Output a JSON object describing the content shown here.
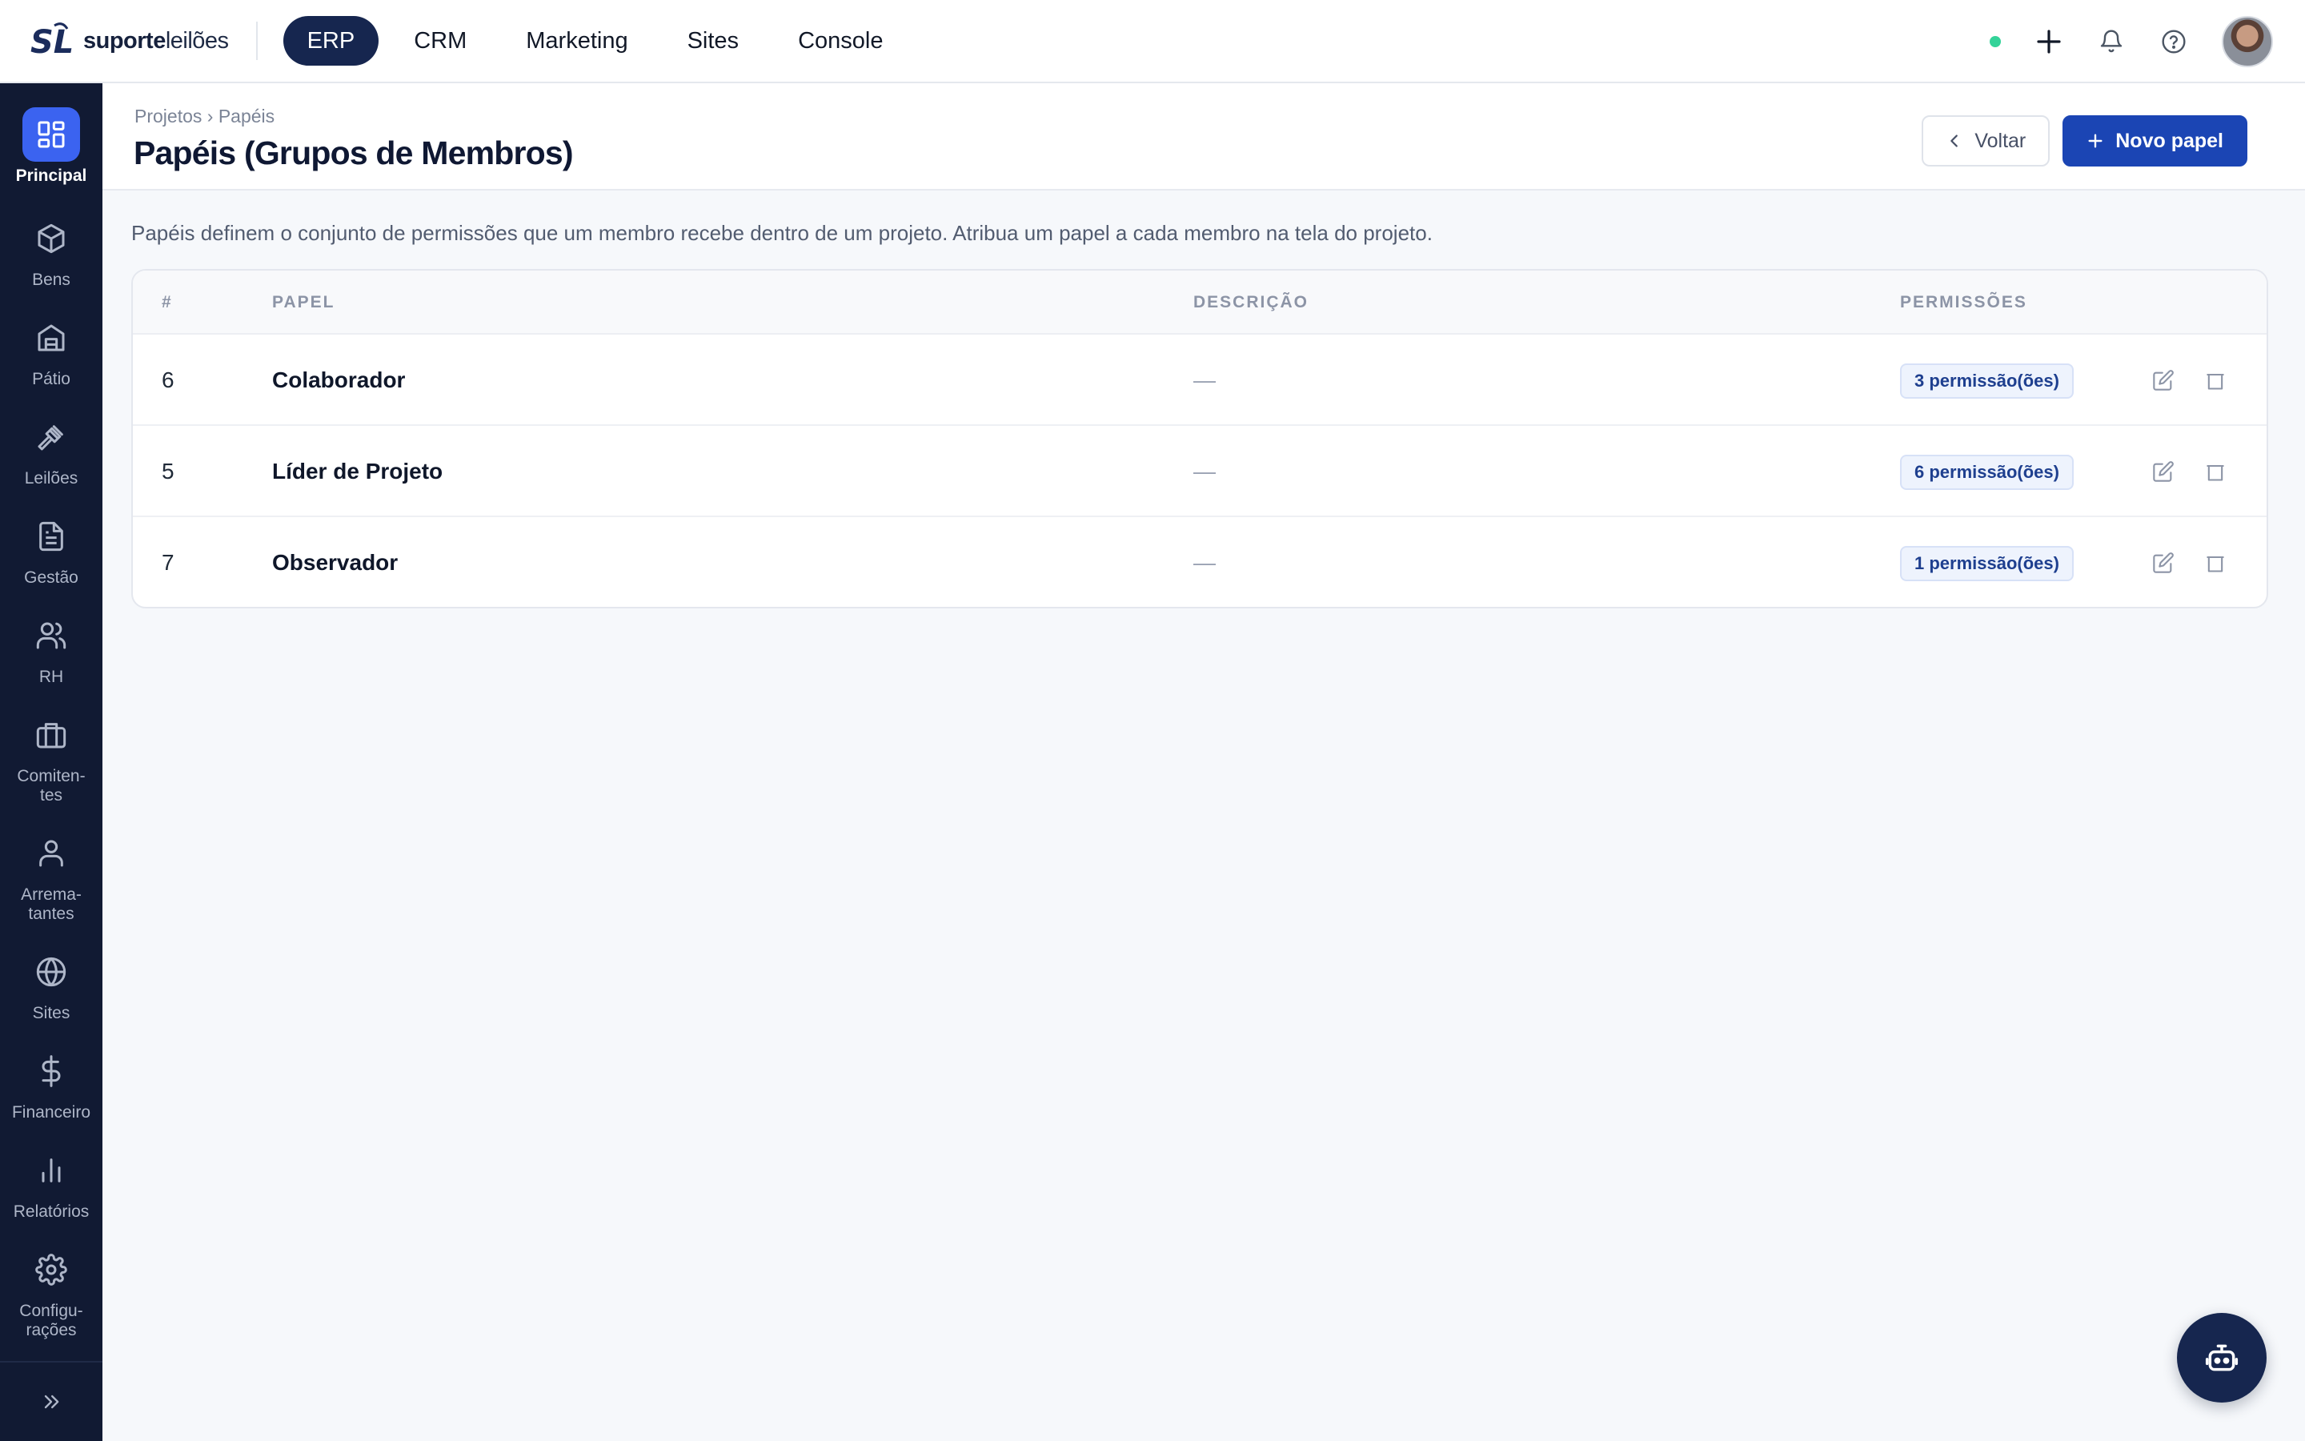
{
  "brand": {
    "bold": "suporte",
    "light": "leilões",
    "mark": "SL"
  },
  "topnav": [
    {
      "label": "ERP",
      "active": true
    },
    {
      "label": "CRM",
      "active": false
    },
    {
      "label": "Marketing",
      "active": false
    },
    {
      "label": "Sites",
      "active": false
    },
    {
      "label": "Console",
      "active": false
    }
  ],
  "sidebar": {
    "items": [
      {
        "label": "Principal",
        "icon": "dashboard-icon",
        "active": true
      },
      {
        "label": "Bens",
        "icon": "box-icon"
      },
      {
        "label": "Pátio",
        "icon": "warehouse-icon"
      },
      {
        "label": "Leilões",
        "icon": "gavel-icon"
      },
      {
        "label": "Gestão",
        "icon": "document-icon"
      },
      {
        "label": "RH",
        "icon": "users-icon"
      },
      {
        "label": "Comiten-\ntes",
        "icon": "briefcase-icon"
      },
      {
        "label": "Arrema-\ntantes",
        "icon": "user-icon"
      },
      {
        "label": "Sites",
        "icon": "globe-icon"
      },
      {
        "label": "Financeiro",
        "icon": "dollar-icon"
      },
      {
        "label": "Relatórios",
        "icon": "bar-chart-icon"
      },
      {
        "label": "Configu-\nrações",
        "icon": "gear-icon"
      }
    ]
  },
  "header": {
    "breadcrumb": "Projetos › Papéis",
    "title": "Papéis (Grupos de Membros)",
    "back_label": "Voltar",
    "new_label": "Novo papel"
  },
  "intro": "Papéis definem o conjunto de permissões que um membro recebe dentro de um projeto. Atribua um papel a cada membro na tela do projeto.",
  "table": {
    "columns": [
      "#",
      "PAPEL",
      "DESCRIÇÃO",
      "PERMISSÕES"
    ],
    "rows": [
      {
        "id": "6",
        "role": "Colaborador",
        "description": "—",
        "permissions": "3 permissão(ões)"
      },
      {
        "id": "5",
        "role": "Líder de Projeto",
        "description": "—",
        "permissions": "6 permissão(ões)"
      },
      {
        "id": "7",
        "role": "Observador",
        "description": "—",
        "permissions": "1 permissão(ões)"
      }
    ]
  },
  "colors": {
    "accent": "#1b45b4",
    "nav_active": "#16264f",
    "sidebar_bg": "#111a33",
    "status_online": "#34d399"
  }
}
